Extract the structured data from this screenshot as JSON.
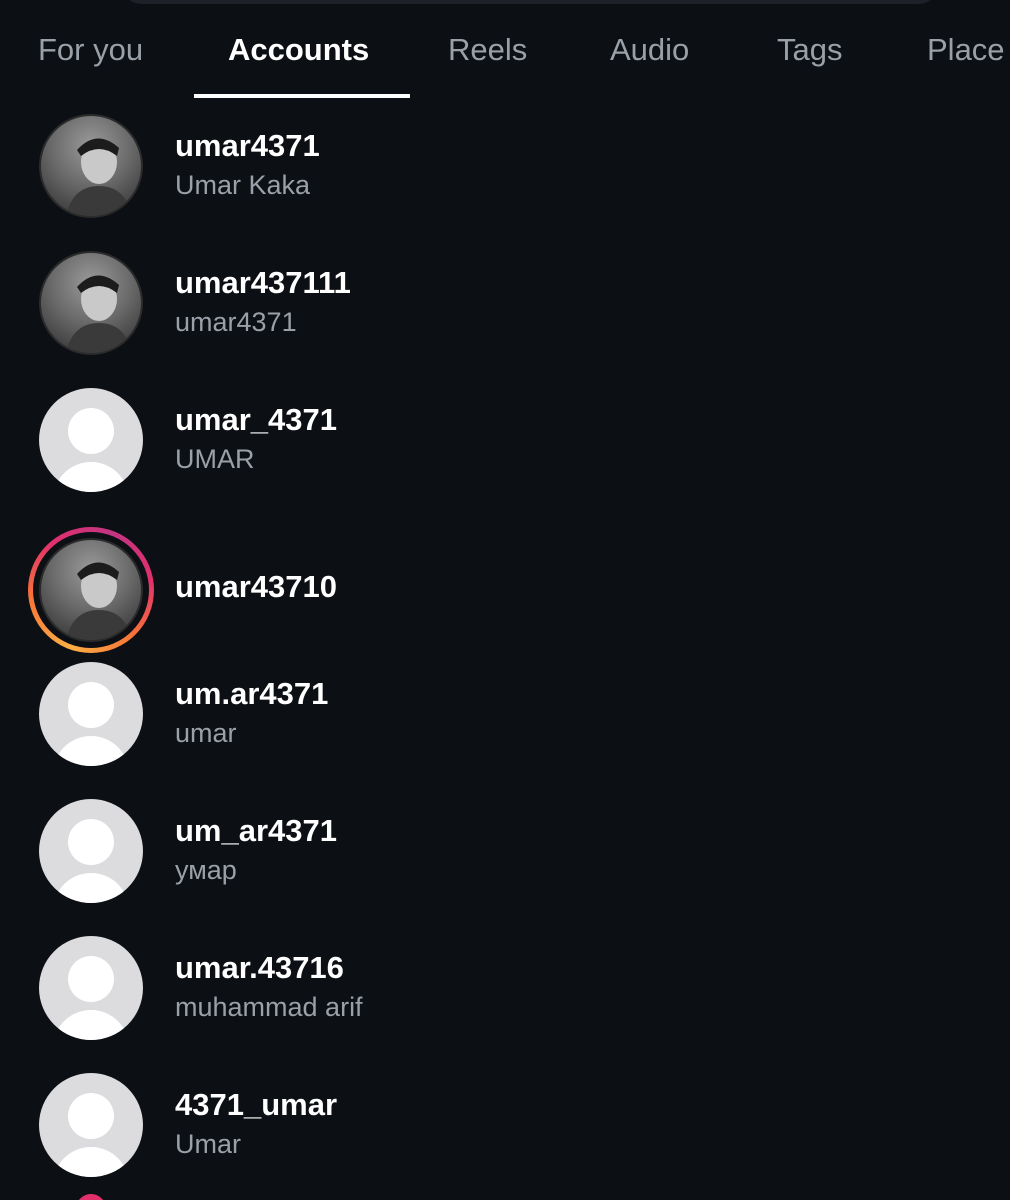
{
  "tabs": [
    {
      "label": "For you"
    },
    {
      "label": "Accounts"
    },
    {
      "label": "Reels"
    },
    {
      "label": "Audio"
    },
    {
      "label": "Tags"
    },
    {
      "label": "Place"
    }
  ],
  "active_tab": "Accounts",
  "accounts": [
    {
      "username": "umar4371",
      "full_name": "Umar Kaka",
      "avatar": "profile-photo"
    },
    {
      "username": "umar437111",
      "full_name": "umar4371",
      "avatar": "profile-photo"
    },
    {
      "username": "umar_4371",
      "full_name": "UMAR",
      "avatar": "default-avatar-icon"
    },
    {
      "username": "umar43710",
      "full_name": "",
      "avatar": "profile-photo",
      "has_story_ring": true
    },
    {
      "username": "um.ar4371",
      "full_name": "umar",
      "avatar": "default-avatar-icon"
    },
    {
      "username": "um_ar4371",
      "full_name": "умар",
      "avatar": "default-avatar-icon"
    },
    {
      "username": "umar.43716",
      "full_name": "muhammad arif",
      "avatar": "default-avatar-icon"
    },
    {
      "username": "4371_umar",
      "full_name": "Umar",
      "avatar": "default-avatar-icon"
    }
  ],
  "colors": {
    "background": "#0c0f14",
    "text_primary": "#ffffff",
    "text_secondary": "#9aa0a7",
    "story_ring": [
      "#fcaf45",
      "#f77737",
      "#e1306c",
      "#c13584"
    ]
  }
}
